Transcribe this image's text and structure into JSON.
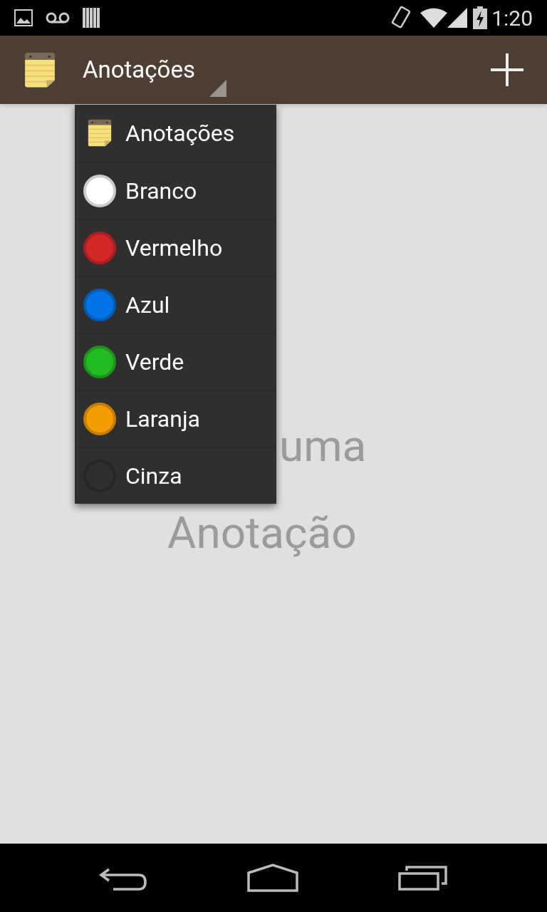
{
  "status_bar": {
    "time": "1:20"
  },
  "action_bar": {
    "title": "Anotações"
  },
  "dropdown": {
    "items": [
      {
        "kind": "notepad",
        "label": "Anotações"
      },
      {
        "kind": "color",
        "label": "Branco",
        "color": "#ffffff"
      },
      {
        "kind": "color",
        "label": "Vermelho",
        "color": "#d32626"
      },
      {
        "kind": "color",
        "label": "Azul",
        "color": "#0073e6"
      },
      {
        "kind": "color",
        "label": "Verde",
        "color": "#22bb22"
      },
      {
        "kind": "color",
        "label": "Laranja",
        "color": "#f49d00"
      },
      {
        "kind": "color",
        "label": "Cinza",
        "color": "#2f2f2f"
      }
    ]
  },
  "empty_message": [
    "uma",
    "Anotação"
  ]
}
